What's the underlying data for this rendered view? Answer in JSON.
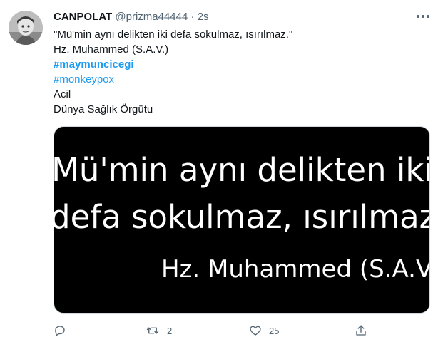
{
  "author": {
    "display_name": "CANPOLAT",
    "handle": "@prizma44444",
    "separator": "·",
    "timestamp": "2s"
  },
  "menu_icon": "more-horizontal",
  "text_lines": [
    "\"Mü'min aynı delikten iki defa sokulmaz, ısırılmaz.\"",
    "Hz. Muhammed (S.A.V.)"
  ],
  "hashtags": [
    "#maymuncicegi",
    "#monkeypox"
  ],
  "extra_lines": [
    "Acil",
    "Dünya Sağlık Örgütu"
  ],
  "media": {
    "line1": "Mü'min aynı delikten iki",
    "line2": "defa sokulmaz, ısırılmaz",
    "line3": "Hz. Muhammed (S.A.V.)"
  },
  "actions": {
    "reply_icon": "reply-icon",
    "reply_count": "",
    "retweet_icon": "retweet-icon",
    "retweet_count": "2",
    "like_icon": "heart-icon",
    "like_count": "25",
    "share_icon": "share-icon"
  },
  "colors": {
    "link": "#1d9bf0",
    "muted": "#536471",
    "text": "#0f1419"
  }
}
